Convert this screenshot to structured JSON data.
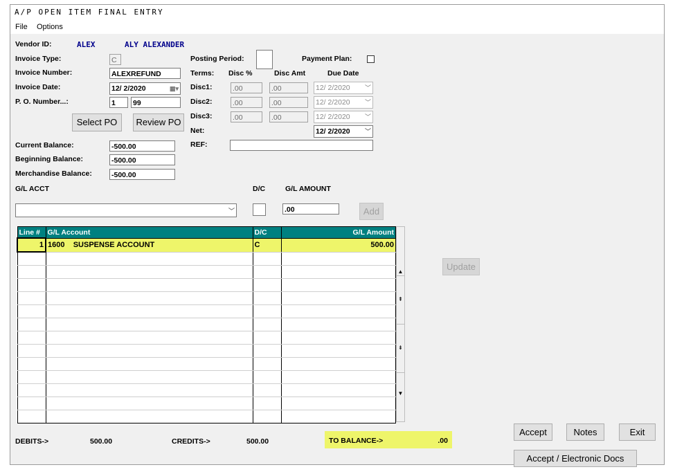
{
  "window": {
    "title": "A/P  OPEN ITEM FINAL ENTRY"
  },
  "menu": {
    "file": "File",
    "options": "Options"
  },
  "vendor": {
    "label": "Vendor ID:",
    "id": "ALEX",
    "name": "ALY ALEXANDER"
  },
  "invoice": {
    "type_label": "Invoice Type:",
    "type_value": "C",
    "number_label": "Invoice Number:",
    "number_value": "ALEXREFUND",
    "date_label": "Invoice Date:",
    "date_value": "12/ 2/2020",
    "po_label": "P. O. Number...:",
    "po_value1": "1",
    "po_value2": "99"
  },
  "buttons": {
    "select_po": "Select PO",
    "review_po": "Review PO",
    "add": "Add",
    "update": "Update",
    "accept": "Accept",
    "notes": "Notes",
    "exit": "Exit",
    "accept_electronic": "Accept / Electronic Docs"
  },
  "posting": {
    "label": "Posting Period:",
    "value": ""
  },
  "payment_plan": {
    "label": "Payment Plan:",
    "checked": false
  },
  "terms": {
    "label": "Terms:",
    "disc_pct": "Disc %",
    "disc_amt": "Disc Amt",
    "due_date": "Due Date",
    "rows": [
      {
        "label": "Disc1:",
        "pct": ".00",
        "amt": ".00",
        "date": "12/ 2/2020"
      },
      {
        "label": "Disc2:",
        "pct": ".00",
        "amt": ".00",
        "date": "12/ 2/2020"
      },
      {
        "label": "Disc3:",
        "pct": ".00",
        "amt": ".00",
        "date": "12/ 2/2020"
      }
    ],
    "net_label": "Net:",
    "net_date": "12/ 2/2020"
  },
  "ref": {
    "label": "REF:",
    "value": ""
  },
  "balances": {
    "current_label": "Current Balance:",
    "current_value": "-500.00",
    "beginning_label": "Beginning Balance:",
    "beginning_value": "-500.00",
    "merch_label": "Merchandise Balance:",
    "merch_value": "-500.00"
  },
  "gl_entry": {
    "acct_label": "G/L ACCT",
    "dc_label": "D/C",
    "amount_label": "G/L AMOUNT",
    "acct_value": "",
    "dc_value": "",
    "amount_value": ".00"
  },
  "grid": {
    "headers": [
      "Line #",
      "G/L Account",
      "D/C",
      "G/L Amount"
    ],
    "rows": [
      {
        "line": "1",
        "account": "1600",
        "desc": "SUSPENSE ACCOUNT",
        "dc": "C",
        "amount": "500.00"
      }
    ]
  },
  "totals": {
    "debits_label": "DEBITS->",
    "debits_value": "500.00",
    "credits_label": "CREDITS->",
    "credits_value": "500.00",
    "balance_label": "TO BALANCE->",
    "balance_value": ".00"
  }
}
